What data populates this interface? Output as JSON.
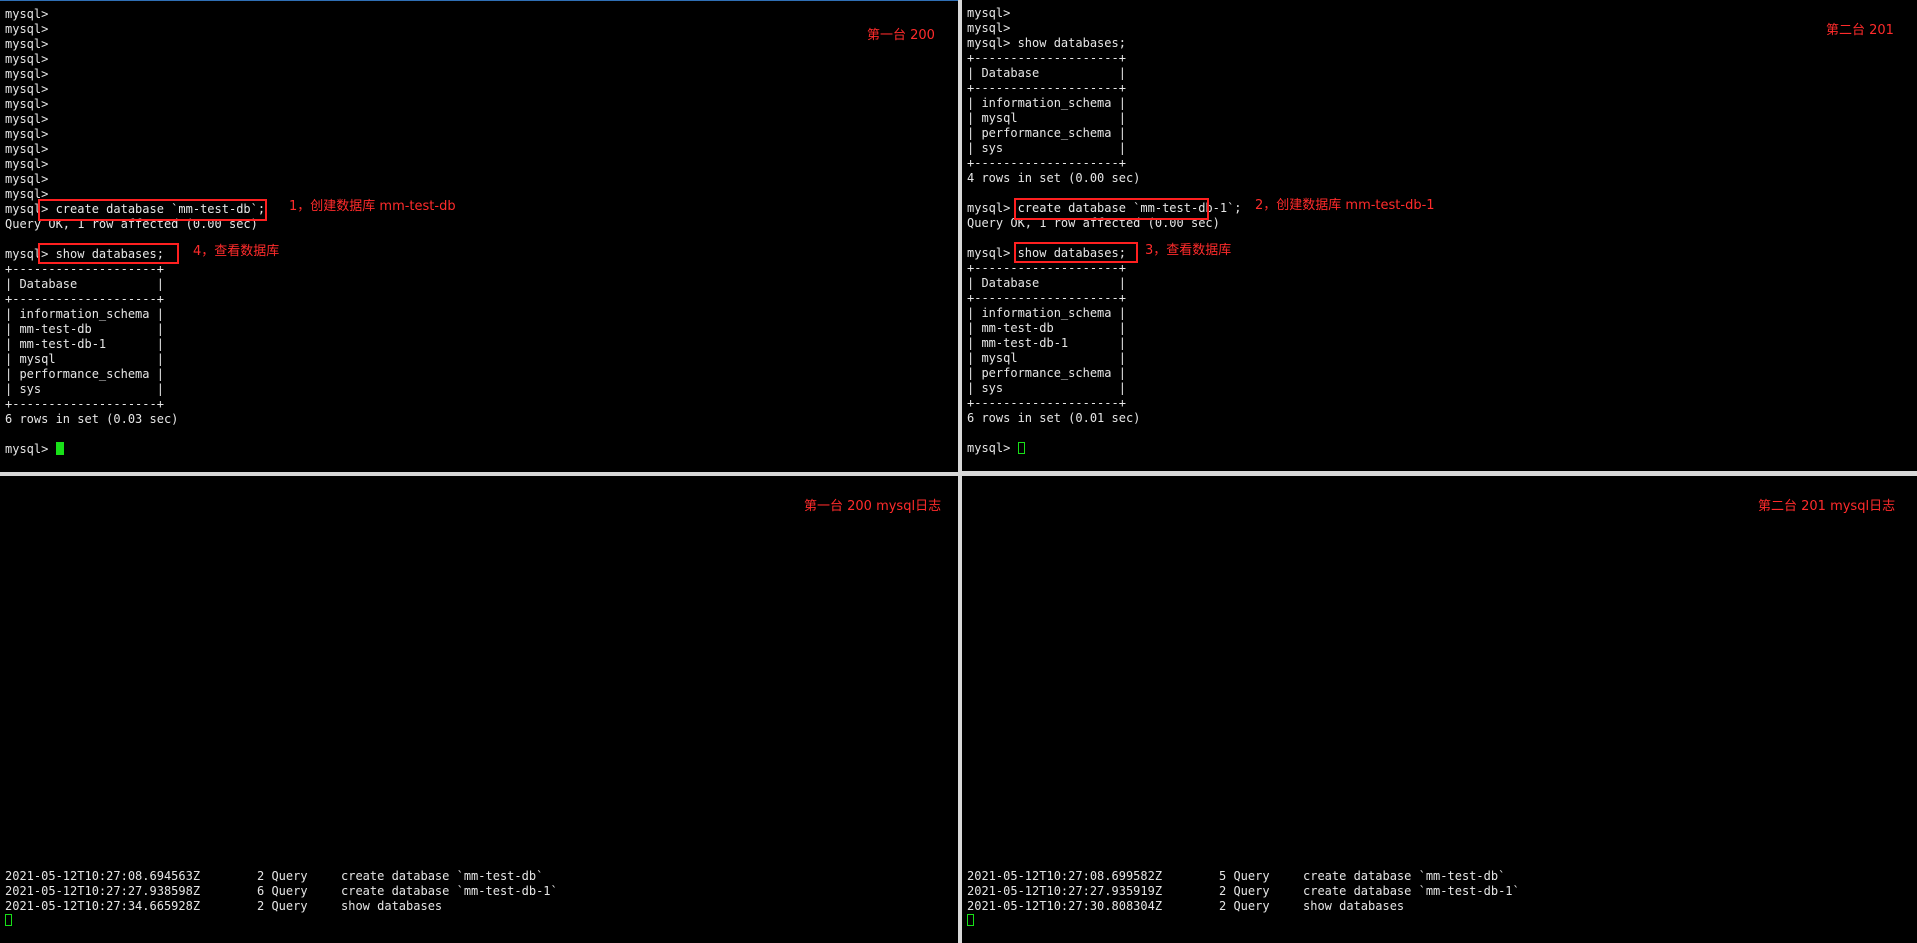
{
  "panes": {
    "top_left": {
      "label": "第一台 200",
      "lines": [
        "mysql>",
        "mysql>",
        "mysql>",
        "mysql>",
        "mysql>",
        "mysql>",
        "mysql>",
        "mysql>",
        "mysql>",
        "mysql>",
        "mysql>",
        "mysql>",
        "mysql>",
        "mysql> create database `mm-test-db`;",
        "Query OK, 1 row affected (0.00 sec)",
        "",
        "mysql> show databases;",
        "+--------------------+",
        "| Database           |",
        "+--------------------+",
        "| information_schema |",
        "| mm-test-db         |",
        "| mm-test-db-1       |",
        "| mysql              |",
        "| performance_schema |",
        "| sys                |",
        "+--------------------+",
        "6 rows in set (0.03 sec)",
        "",
        "mysql> "
      ],
      "annotation_1": "1，创建数据库 mm-test-db",
      "annotation_2": "4，查看数据库"
    },
    "top_right": {
      "label": "第二台 201",
      "lines": [
        "mysql>",
        "mysql>",
        "mysql> show databases;",
        "+--------------------+",
        "| Database           |",
        "+--------------------+",
        "| information_schema |",
        "| mysql              |",
        "| performance_schema |",
        "| sys                |",
        "+--------------------+",
        "4 rows in set (0.00 sec)",
        "",
        "mysql> create database `mm-test-db-1`;",
        "Query OK, 1 row affected (0.00 sec)",
        "",
        "mysql> show databases;",
        "+--------------------+",
        "| Database           |",
        "+--------------------+",
        "| information_schema |",
        "| mm-test-db         |",
        "| mm-test-db-1       |",
        "| mysql              |",
        "| performance_schema |",
        "| sys                |",
        "+--------------------+",
        "6 rows in set (0.01 sec)",
        "",
        "mysql> "
      ],
      "annotation_1": "2，创建数据库 mm-test-db-1",
      "annotation_2": "3，查看数据库"
    },
    "bottom_left": {
      "label": "第一台 200 mysql日志",
      "log": [
        {
          "ts": "2021-05-12T10:27:08.694563Z",
          "id": "2 Query",
          "cmd": "create database `mm-test-db`"
        },
        {
          "ts": "2021-05-12T10:27:27.938598Z",
          "id": "6 Query",
          "cmd": "create database `mm-test-db-1`"
        },
        {
          "ts": "2021-05-12T10:27:34.665928Z",
          "id": "2 Query",
          "cmd": "show databases"
        }
      ]
    },
    "bottom_right": {
      "label": "第二台 201 mysql日志",
      "log": [
        {
          "ts": "2021-05-12T10:27:08.699582Z",
          "id": "5 Query",
          "cmd": "create database `mm-test-db`"
        },
        {
          "ts": "2021-05-12T10:27:27.935919Z",
          "id": "2 Query",
          "cmd": "create database `mm-test-db-1`"
        },
        {
          "ts": "2021-05-12T10:27:30.808304Z",
          "id": "2 Query",
          "cmd": "show databases"
        }
      ]
    }
  },
  "colors": {
    "background": "#000000",
    "text": "#e6e6e6",
    "annotation": "#ff2b2b",
    "cursor": "#18e018",
    "separator": "#d8d8d8"
  }
}
